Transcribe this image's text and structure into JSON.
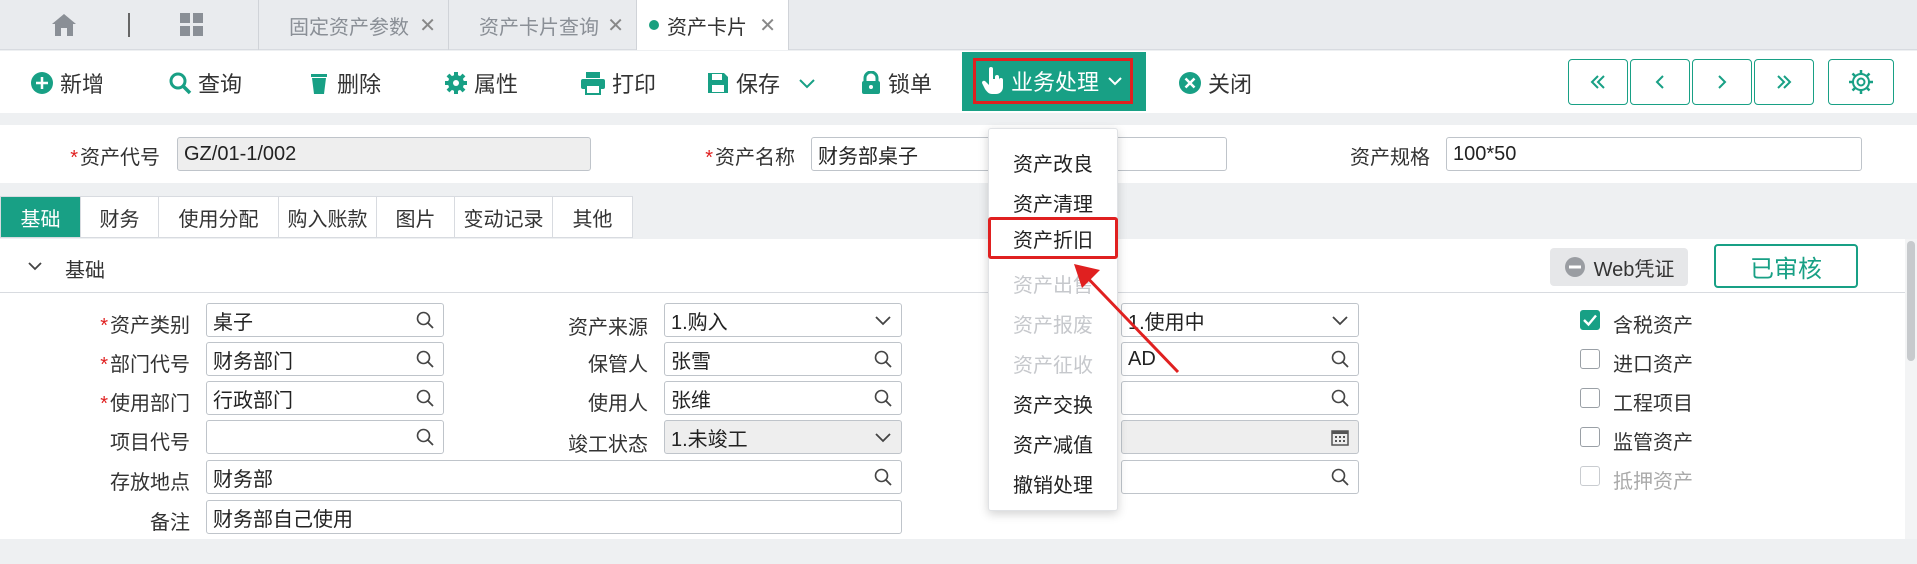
{
  "tabs": [
    {
      "label": "固定资产参数"
    },
    {
      "label": "资产卡片查询"
    },
    {
      "label": "资产卡片"
    }
  ],
  "toolbar": {
    "add": "新增",
    "query": "查询",
    "delete": "删除",
    "props": "属性",
    "print": "打印",
    "save": "保存",
    "lock": "锁单",
    "business": "业务处理",
    "close": "关闭"
  },
  "header": {
    "asset_code_label": "资产代号",
    "asset_code": "GZ/01-1/002",
    "asset_name_label": "资产名称",
    "asset_name": "财务部桌子",
    "spec_label": "资产规格",
    "spec": "100*50"
  },
  "section_tabs": [
    "基础",
    "财务",
    "使用分配",
    "购入账款",
    "图片",
    "变动记录",
    "其他"
  ],
  "section": {
    "title": "基础",
    "web_voucher": "Web凭证",
    "audit_stamp": "已审核"
  },
  "form": {
    "category_label": "资产类别",
    "category": "桌子",
    "dept_label": "部门代号",
    "dept": "财务部门",
    "use_dept_label": "使用部门",
    "use_dept": "行政部门",
    "project_label": "项目代号",
    "project": "",
    "location_label": "存放地点",
    "location": "财务部",
    "remark_label": "备注",
    "remark": "财务部自己使用",
    "source_label": "资产来源",
    "source": "1.购入",
    "keeper_label": "保管人",
    "keeper": "张雪",
    "user_label": "使用人",
    "user": "张维",
    "completion_label": "竣工状态",
    "completion": "1.未竣工",
    "status": "1.使用中",
    "col3_row2": "AD"
  },
  "checkboxes": [
    {
      "label": "含税资产",
      "checked": true
    },
    {
      "label": "进口资产",
      "checked": false
    },
    {
      "label": "工程项目",
      "checked": false
    },
    {
      "label": "监管资产",
      "checked": false
    },
    {
      "label": "抵押资产",
      "checked": false,
      "disabled": true
    }
  ],
  "dropdown": [
    {
      "label": "资产改良",
      "disabled": false
    },
    {
      "label": "资产清理",
      "disabled": false
    },
    {
      "label": "资产折旧",
      "disabled": false,
      "highlighted": true
    },
    {
      "label": "资产出售",
      "disabled": true
    },
    {
      "label": "资产报废",
      "disabled": true
    },
    {
      "label": "资产征收",
      "disabled": true
    },
    {
      "label": "资产交换",
      "disabled": false
    },
    {
      "label": "资产减值",
      "disabled": false
    },
    {
      "label": "撤销处理",
      "disabled": false
    }
  ],
  "colors": {
    "accent": "#18a085",
    "highlight": "#e02020"
  }
}
